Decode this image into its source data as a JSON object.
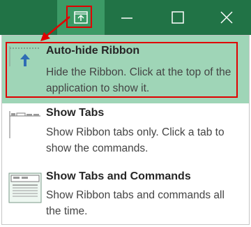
{
  "window_controls": {
    "ribbon_options_icon": "ribbon-display-options-icon",
    "minimize_icon": "minimize-icon",
    "maximize_icon": "maximize-icon",
    "close_icon": "close-icon"
  },
  "menu": {
    "items": [
      {
        "title": "Auto-hide Ribbon",
        "description": "Hide the Ribbon. Click at the top of the application to show it.",
        "icon": "auto-hide-ribbon-icon",
        "selected": true
      },
      {
        "title": "Show Tabs",
        "description": "Show Ribbon tabs only. Click a tab to show the commands.",
        "icon": "show-tabs-icon",
        "selected": false
      },
      {
        "title": "Show Tabs and Commands",
        "description": "Show Ribbon tabs and commands all the time.",
        "icon": "show-tabs-and-commands-icon",
        "selected": false
      }
    ]
  },
  "colors": {
    "titlebar": "#217346",
    "selected_item": "#9fd5b7",
    "annotation": "#e00000"
  }
}
